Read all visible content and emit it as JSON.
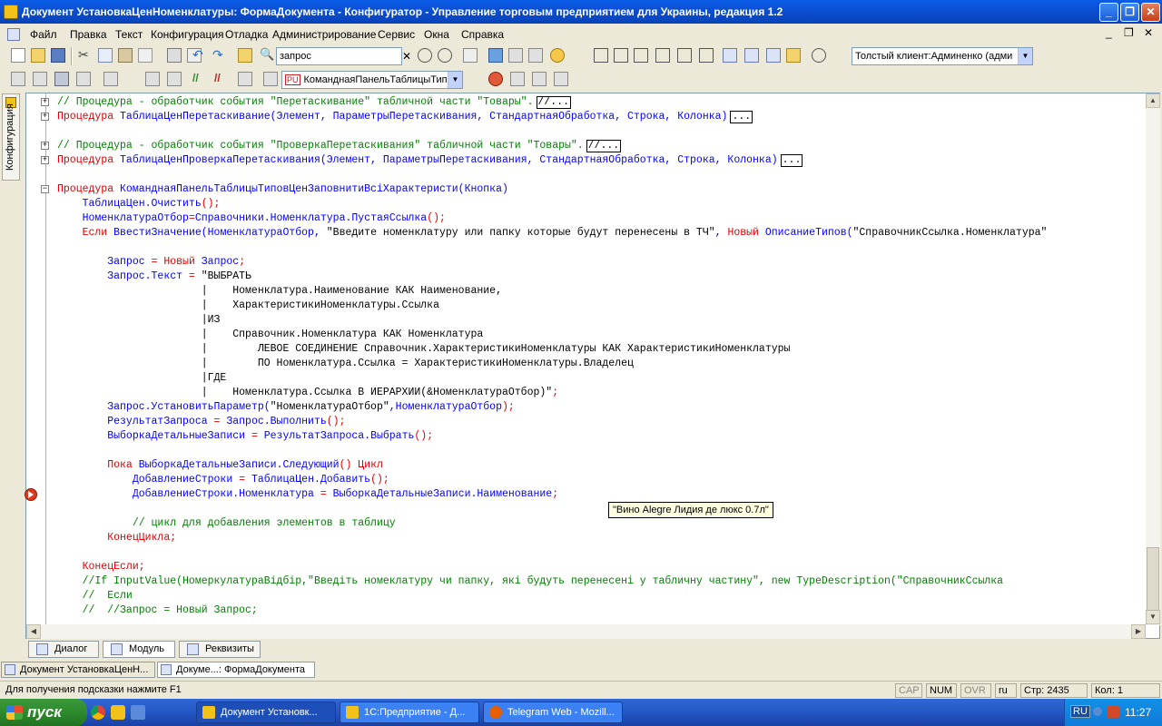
{
  "window": {
    "title": "Документ УстановкаЦенНоменклатуры: ФормаДокумента - Конфигуратор - Управление торговым предприятием для Украины, редакция 1.2",
    "minimize": "_",
    "maximize": "❐",
    "close": "✕"
  },
  "menu": {
    "items": [
      "Файл",
      "Правка",
      "Текст",
      "Конфигурация",
      "Отладка",
      "Администрирование",
      "Сервис",
      "Окна",
      "Справка"
    ],
    "mdi_minimize": "_",
    "mdi_restore": "❐",
    "mdi_close": "✕"
  },
  "toolbar": {
    "search_value": "запрос",
    "search_clear": "✕",
    "client_select": "Толстый клиент:Админенко (адми",
    "module_select": "КоманднаяПанельТаблицыТип",
    "module_badge": "PU"
  },
  "left_panel": {
    "tab_label": "Конфигурация"
  },
  "code": {
    "lines": [
      {
        "parts": [
          {
            "t": "// Процедура - обработчик события \"Перетаскивание\" табличной части \"Товары\".",
            "c": "cm"
          }
        ],
        "box": "//..."
      },
      {
        "parts": [
          {
            "t": "Процедура ",
            "c": "kw"
          },
          {
            "t": "ТаблицаЦенПеретаскивание(Элемент, ПараметрыПеретаскивания, СтандартнаяОбработка, Строка, Колонка)",
            "c": "id"
          }
        ],
        "box": "..."
      },
      {
        "parts": [
          {
            "t": "",
            "c": "st"
          }
        ]
      },
      {
        "parts": [
          {
            "t": "// Процедура - обработчик события \"ПроверкаПеретаскивания\" табличной части \"Товары\".",
            "c": "cm"
          }
        ],
        "box": "//..."
      },
      {
        "parts": [
          {
            "t": "Процедура ",
            "c": "kw"
          },
          {
            "t": "ТаблицаЦенПроверкаПеретаскивания(Элемент, ПараметрыПеретаскивания, СтандартнаяОбработка, Строка, Колонка)",
            "c": "id"
          }
        ],
        "box": "..."
      },
      {
        "parts": [
          {
            "t": "",
            "c": "st"
          }
        ]
      },
      {
        "parts": [
          {
            "t": "Процедура ",
            "c": "kw"
          },
          {
            "t": "КоманднаяПанельТаблицыТиповЦенЗаповнитиВсіХарактеристи(Кнопка)",
            "c": "id"
          }
        ]
      },
      {
        "parts": [
          {
            "t": "    ТаблицаЦен.Очистить",
            "c": "id"
          },
          {
            "t": "();",
            "c": "op"
          }
        ]
      },
      {
        "parts": [
          {
            "t": "    НоменклатураОтбор",
            "c": "id"
          },
          {
            "t": "=",
            "c": "op"
          },
          {
            "t": "Справочники.Номенклатура.ПустаяСсылка",
            "c": "id"
          },
          {
            "t": "();",
            "c": "op"
          }
        ]
      },
      {
        "parts": [
          {
            "t": "    Если ",
            "c": "kw"
          },
          {
            "t": "ВвестиЗначение(НоменклатураОтбор, ",
            "c": "id"
          },
          {
            "t": "\"Введите номенклатуру или папку которые будут перенесены в ТЧ\"",
            "c": "st"
          },
          {
            "t": ", ",
            "c": "id"
          },
          {
            "t": "Новый ",
            "c": "kw"
          },
          {
            "t": "ОписаниеТипов(",
            "c": "id"
          },
          {
            "t": "\"СправочникСсылка.Номенклатура\"",
            "c": "st"
          }
        ]
      },
      {
        "parts": [
          {
            "t": "",
            "c": "st"
          }
        ]
      },
      {
        "parts": [
          {
            "t": "        Запрос ",
            "c": "id"
          },
          {
            "t": "= ",
            "c": "op"
          },
          {
            "t": "Новый ",
            "c": "kw"
          },
          {
            "t": "Запрос",
            "c": "id"
          },
          {
            "t": ";",
            "c": "op"
          }
        ]
      },
      {
        "parts": [
          {
            "t": "        Запрос.Текст ",
            "c": "id"
          },
          {
            "t": "= ",
            "c": "op"
          },
          {
            "t": "\"ВЫБРАТЬ",
            "c": "st"
          }
        ]
      },
      {
        "parts": [
          {
            "t": "                       |    Номенклатура.Наименование КАК Наименование,",
            "c": "st"
          }
        ]
      },
      {
        "parts": [
          {
            "t": "                       |    ХарактеристикиНоменклатуры.Ссылка",
            "c": "st"
          }
        ]
      },
      {
        "parts": [
          {
            "t": "                       |ИЗ",
            "c": "st"
          }
        ]
      },
      {
        "parts": [
          {
            "t": "                       |    Справочник.Номенклатура КАК Номенклатура",
            "c": "st"
          }
        ]
      },
      {
        "parts": [
          {
            "t": "                       |        ЛЕВОЕ СОЕДИНЕНИЕ Справочник.ХарактеристикиНоменклатуры КАК ХарактеристикиНоменклатуры",
            "c": "st"
          }
        ]
      },
      {
        "parts": [
          {
            "t": "                       |        ПО Номенклатура.Ссылка = ХарактеристикиНоменклатуры.Владелец",
            "c": "st"
          }
        ]
      },
      {
        "parts": [
          {
            "t": "                       |ГДЕ",
            "c": "st"
          }
        ]
      },
      {
        "parts": [
          {
            "t": "                       |    Номенклатура.Ссылка В ИЕРАРХИИ(&НоменклатураОтбор)\"",
            "c": "st"
          },
          {
            "t": ";",
            "c": "op"
          }
        ]
      },
      {
        "parts": [
          {
            "t": "        Запрос.УстановитьПараметр(",
            "c": "id"
          },
          {
            "t": "\"НоменклатураОтбор\"",
            "c": "st"
          },
          {
            "t": ",НоменклатураОтбор",
            "c": "id"
          },
          {
            "t": ");",
            "c": "op"
          }
        ]
      },
      {
        "parts": [
          {
            "t": "        РезультатЗапроса ",
            "c": "id"
          },
          {
            "t": "= ",
            "c": "op"
          },
          {
            "t": "Запрос.Выполнить",
            "c": "id"
          },
          {
            "t": "();",
            "c": "op"
          }
        ]
      },
      {
        "parts": [
          {
            "t": "        ВыборкаДетальныеЗаписи ",
            "c": "id"
          },
          {
            "t": "= ",
            "c": "op"
          },
          {
            "t": "РезультатЗапроса.Выбрать",
            "c": "id"
          },
          {
            "t": "();",
            "c": "op"
          }
        ]
      },
      {
        "parts": [
          {
            "t": "",
            "c": "st"
          }
        ]
      },
      {
        "parts": [
          {
            "t": "        Пока ",
            "c": "kw"
          },
          {
            "t": "ВыборкаДетальныеЗаписи.Следующий",
            "c": "id"
          },
          {
            "t": "() ",
            "c": "op"
          },
          {
            "t": "Цикл",
            "c": "kw"
          }
        ]
      },
      {
        "parts": [
          {
            "t": "            ДобавлениеСтроки ",
            "c": "id"
          },
          {
            "t": "= ",
            "c": "op"
          },
          {
            "t": "ТаблицаЦен.Добавить",
            "c": "id"
          },
          {
            "t": "();",
            "c": "op"
          }
        ]
      },
      {
        "parts": [
          {
            "t": "            ДобавлениеСтроки.Номенклатура ",
            "c": "id"
          },
          {
            "t": "= ",
            "c": "op"
          },
          {
            "t": "ВыборкаДетальныеЗаписи.Наименование",
            "c": "id"
          },
          {
            "t": ";",
            "c": "op"
          }
        ]
      },
      {
        "parts": [
          {
            "t": "",
            "c": "st"
          }
        ]
      },
      {
        "parts": [
          {
            "t": "            // цикл для добавления элементов в таблицу",
            "c": "cm"
          }
        ]
      },
      {
        "parts": [
          {
            "t": "        КонецЦикла",
            "c": "kw"
          },
          {
            "t": ";",
            "c": "op"
          }
        ]
      },
      {
        "parts": [
          {
            "t": "",
            "c": "st"
          }
        ]
      },
      {
        "parts": [
          {
            "t": "    КонецЕсли",
            "c": "kw"
          },
          {
            "t": ";",
            "c": "op"
          }
        ]
      },
      {
        "parts": [
          {
            "t": "    //If InputValue(НомеркулатураВідбір,\"Введіть номеклатуру чи папку, які будуть перенесені у табличну частину\", new TypeDescription(\"СправочникСсылка",
            "c": "cm"
          }
        ]
      },
      {
        "parts": [
          {
            "t": "    //  Если",
            "c": "cm"
          }
        ]
      },
      {
        "parts": [
          {
            "t": "    //  //Запрос = Новый Запрос;",
            "c": "cm"
          }
        ]
      }
    ],
    "tooltip": "\"Вино Alegre Лидия де люкс 0.7л\""
  },
  "bottom_tabs": [
    "Диалог",
    "Модуль",
    "Реквизиты"
  ],
  "window_tabs": [
    "Документ УстановкаЦенН...",
    "Докуме...: ФормаДокумента"
  ],
  "status": {
    "hint": "Для получения подсказки нажмите F1",
    "cap": "CAP",
    "num": "NUM",
    "ovr": "OVR",
    "lang": "ru",
    "line": "Стр: 2435",
    "col": "Кол: 1"
  },
  "taskbar": {
    "start": "пуск",
    "tasks": [
      "Документ Установк...",
      "1С:Предприятие - Д...",
      "Telegram Web - Mozill..."
    ],
    "lang": "RU",
    "time": "11:27"
  }
}
